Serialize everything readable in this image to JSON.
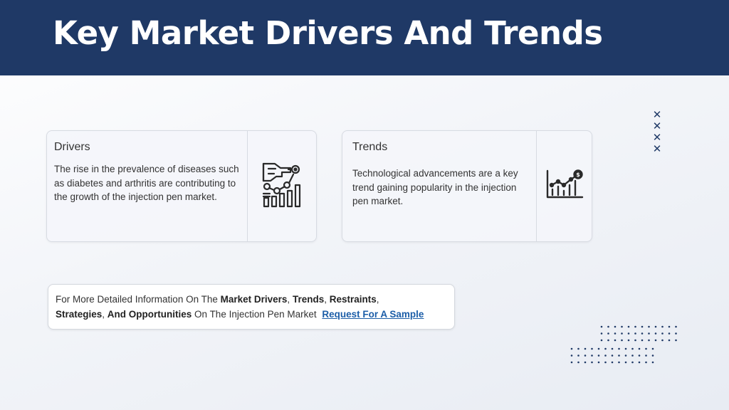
{
  "header": {
    "title": "Key Market Drivers And Trends",
    "background": "#1f3966"
  },
  "drivers": {
    "title": "Drivers",
    "body": "The rise in the prevalence of diseases such as diabetes and arthritis are contributing to the growth of the injection pen market.",
    "icon": "growth-chart-hand-icon"
  },
  "trends": {
    "title": "Trends",
    "body": "Technological advancements are a key trend gaining popularity in the injection pen market.",
    "icon": "bar-chart-dollar-icon"
  },
  "decor": {
    "cross_glyph": "✕",
    "accent": "#1f3966"
  },
  "info": {
    "t1": "For More Detailed Information On The ",
    "b1": "Market Drivers",
    "t2": ", ",
    "b2": "Trends",
    "t3": ", ",
    "b3": "Restraints",
    "t4": ",",
    "b4": "Strategies",
    "t5": ", ",
    "b5": "And Opportunities",
    "t6": " On The Injection Pen Market",
    "link": "Request For A Sample",
    "link_color": "#1c5ea8"
  }
}
